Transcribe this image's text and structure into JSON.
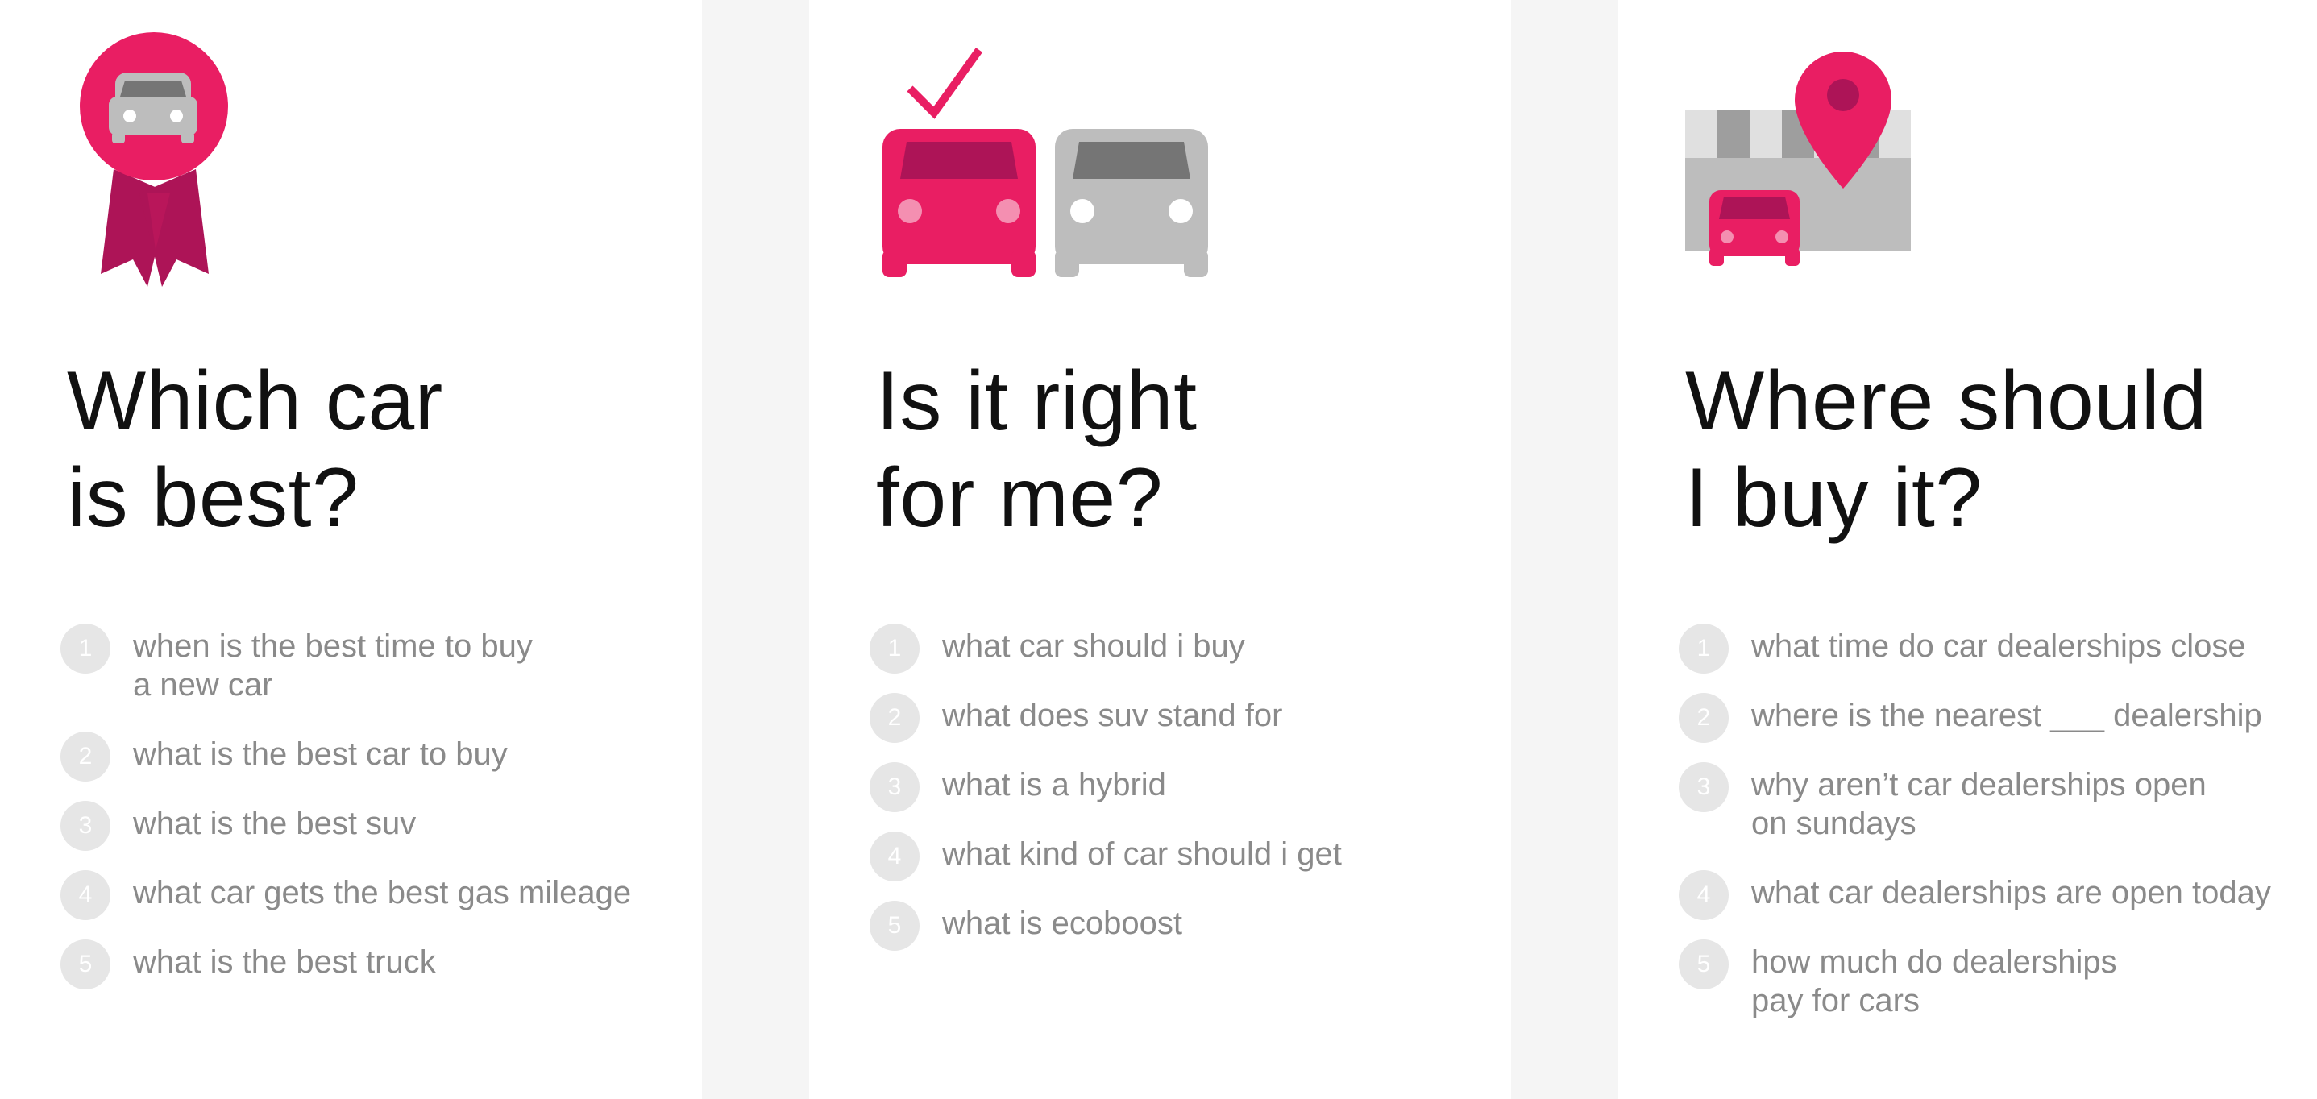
{
  "colors": {
    "accent": "#e91e63",
    "accent_dark": "#ad1457",
    "gray_car": "#bdbdbd",
    "gray_dark": "#757575",
    "number_badge": "#e6e6e6",
    "text_gray": "#8a8a8a",
    "heading": "#111111",
    "gutter": "#f5f5f5"
  },
  "columns": [
    {
      "icon": "award-ribbon-car-icon",
      "heading_line1": "Which car",
      "heading_line2": "is best?",
      "items": [
        {
          "num": "1",
          "text": "when is the best time to buy\n a new car"
        },
        {
          "num": "2",
          "text": "what is the best car to buy"
        },
        {
          "num": "3",
          "text": "what is the best suv"
        },
        {
          "num": "4",
          "text": "what car gets the best gas mileage"
        },
        {
          "num": "5",
          "text": "what is the best truck"
        }
      ]
    },
    {
      "icon": "car-comparison-check-icon",
      "heading_line1": "Is it right",
      "heading_line2": "for me?",
      "items": [
        {
          "num": "1",
          "text": "what car should i buy"
        },
        {
          "num": "2",
          "text": "what does suv stand for"
        },
        {
          "num": "3",
          "text": "what is a hybrid"
        },
        {
          "num": "4",
          "text": "what kind of car should i get"
        },
        {
          "num": "5",
          "text": "what is ecoboost"
        }
      ]
    },
    {
      "icon": "dealership-location-icon",
      "heading_line1": "Where should",
      "heading_line2": "I buy it?",
      "items": [
        {
          "num": "1",
          "text": "what time do car dealerships close"
        },
        {
          "num": "2",
          "text": "where is the nearest ___ dealership"
        },
        {
          "num": "3",
          "text": "why aren’t car dealerships open\non sundays"
        },
        {
          "num": "4",
          "text": "what car dealerships are open today"
        },
        {
          "num": "5",
          "text": "how much do dealerships\npay for cars"
        }
      ]
    }
  ]
}
